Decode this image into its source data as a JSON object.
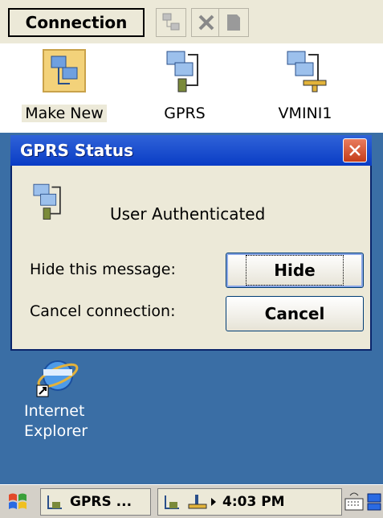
{
  "connections_window": {
    "menu_label": "Connection",
    "items": [
      {
        "label": "Make New",
        "icon": "make-new-connection-icon"
      },
      {
        "label": "GPRS",
        "icon": "network-connection-icon"
      },
      {
        "label": "VMINI1",
        "icon": "network-connection-icon"
      }
    ]
  },
  "dialog": {
    "title": "GPRS Status",
    "status_text": "User Authenticated",
    "hide_label": "Hide this message:",
    "hide_button": "Hide",
    "cancel_label": "Cancel connection:",
    "cancel_button": "Cancel"
  },
  "desktop": {
    "icons": [
      {
        "label_line1": "Internet",
        "label_line2": "Explorer",
        "icon": "internet-explorer-icon"
      }
    ]
  },
  "taskbar": {
    "task_label": "GPRS ...",
    "time": "4:03 PM"
  },
  "colors": {
    "titlebar": "#0a3cc5",
    "desktop": "#3a6ea5",
    "dialog_bg": "#ece9d8",
    "close_button": "#c43d1a"
  }
}
